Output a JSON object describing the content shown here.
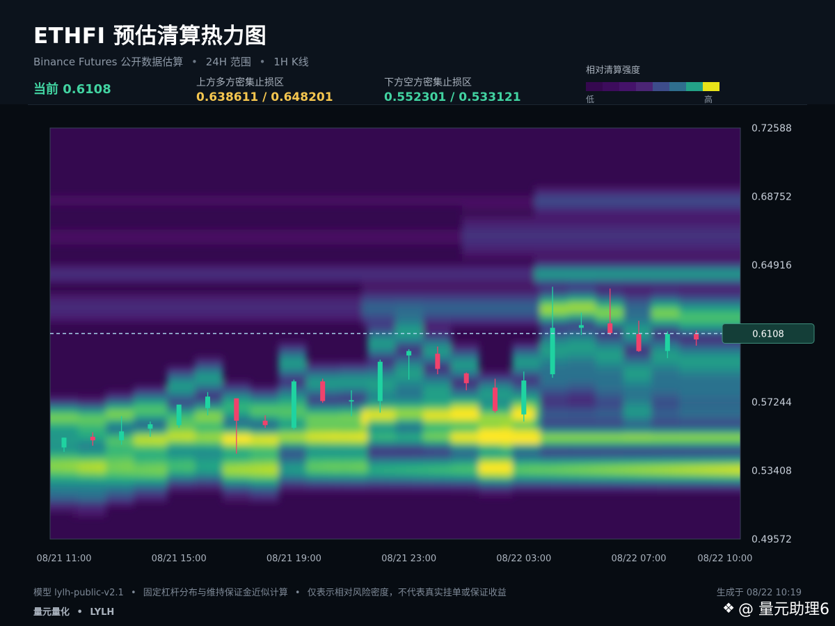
{
  "header": {
    "title": "ETHFI 预估清算热力图",
    "subtitle_source": "Binance Futures 公开数据估算",
    "subtitle_range": "24H 范围",
    "subtitle_interval": "1H K线",
    "separator": "•",
    "current_label": "当前 0.6108",
    "upper_zone_label": "上方多方密集止损区",
    "upper_zone_value": "0.638611 / 0.648201",
    "lower_zone_label": "下方空方密集止损区",
    "lower_zone_value": "0.552301 / 0.533121"
  },
  "legend": {
    "title": "相对清算强度",
    "low": "低",
    "high": "高",
    "colors": [
      "#35084f",
      "#3d0c5c",
      "#45136a",
      "#4b2575",
      "#3d4c8a",
      "#2f6e8e",
      "#23a287",
      "#e8e419"
    ]
  },
  "chart_data": {
    "type": "heatmap",
    "title": "",
    "xlabel": "",
    "ylabel": "",
    "ylim": [
      0.49572,
      0.72588
    ],
    "y_ticks": [
      "0.72588",
      "0.68752",
      "0.64916",
      "0.61080",
      "0.57244",
      "0.53408",
      "0.49572"
    ],
    "y_tick_labels": [
      "0.72588",
      "0.68752",
      "0.64916",
      "",
      "0.57244",
      "0.53408",
      "0.49572"
    ],
    "x_ticks": [
      {
        "h": 0,
        "label": "08/21 11:00"
      },
      {
        "h": 4,
        "label": "08/21 15:00"
      },
      {
        "h": 8,
        "label": "08/21 19:00"
      },
      {
        "h": 12,
        "label": "08/21 23:00"
      },
      {
        "h": 16,
        "label": "08/22 03:00"
      },
      {
        "h": 20,
        "label": "08/22 07:00"
      },
      {
        "h": 23,
        "label": "08/22 10:00"
      }
    ],
    "current_price": 0.6108,
    "current_price_label": "0.6108",
    "upper_zones": [
      0.638611,
      0.648201
    ],
    "lower_zones": [
      0.552301,
      0.533121
    ],
    "candles": [
      {
        "o": 0.547,
        "h": 0.5525,
        "l": 0.5445,
        "c": 0.5525
      },
      {
        "o": 0.553,
        "h": 0.5555,
        "l": 0.548,
        "c": 0.551
      },
      {
        "o": 0.551,
        "h": 0.5645,
        "l": 0.5485,
        "c": 0.556
      },
      {
        "o": 0.5575,
        "h": 0.5615,
        "l": 0.553,
        "c": 0.56
      },
      {
        "o": 0.5595,
        "h": 0.57,
        "l": 0.558,
        "c": 0.571
      },
      {
        "o": 0.569,
        "h": 0.578,
        "l": 0.565,
        "c": 0.5755
      },
      {
        "o": 0.5745,
        "h": 0.5745,
        "l": 0.5435,
        "c": 0.562
      },
      {
        "o": 0.562,
        "h": 0.565,
        "l": 0.558,
        "c": 0.5595
      },
      {
        "o": 0.558,
        "h": 0.585,
        "l": 0.557,
        "c": 0.584
      },
      {
        "o": 0.584,
        "h": 0.5855,
        "l": 0.572,
        "c": 0.573
      },
      {
        "o": 0.573,
        "h": 0.579,
        "l": 0.5645,
        "c": 0.5735
      },
      {
        "o": 0.573,
        "h": 0.5962,
        "l": 0.5665,
        "c": 0.595
      },
      {
        "o": 0.5985,
        "h": 0.602,
        "l": 0.585,
        "c": 0.601
      },
      {
        "o": 0.5995,
        "h": 0.6035,
        "l": 0.588,
        "c": 0.591
      },
      {
        "o": 0.5885,
        "h": 0.589,
        "l": 0.579,
        "c": 0.583
      },
      {
        "o": 0.5805,
        "h": 0.5855,
        "l": 0.5665,
        "c": 0.5675
      },
      {
        "o": 0.5655,
        "h": 0.5895,
        "l": 0.5615,
        "c": 0.5845
      },
      {
        "o": 0.588,
        "h": 0.637,
        "l": 0.586,
        "c": 0.614
      },
      {
        "o": 0.614,
        "h": 0.6225,
        "l": 0.61,
        "c": 0.6155
      },
      {
        "o": 0.6165,
        "h": 0.636,
        "l": 0.61,
        "c": 0.611
      },
      {
        "o": 0.6105,
        "h": 0.618,
        "l": 0.6005,
        "c": 0.601
      },
      {
        "o": 0.601,
        "h": 0.612,
        "l": 0.597,
        "c": 0.6105
      },
      {
        "o": 0.6105,
        "h": 0.6125,
        "l": 0.604,
        "c": 0.6075
      }
    ]
  },
  "footer": {
    "model": "模型 lylh-public-v2.1",
    "method": "固定杠杆分布与维持保证金近似计算",
    "disclaimer": "仅表示相对风险密度，不代表真实挂单或保证收益",
    "separator": "•",
    "brand_name": "量元量化",
    "brand_code": "LYLH",
    "generated": "生成于 08/22 10:19"
  },
  "watermark": {
    "icon": "diamond-logo-icon",
    "text": "@ 量元助理6"
  }
}
